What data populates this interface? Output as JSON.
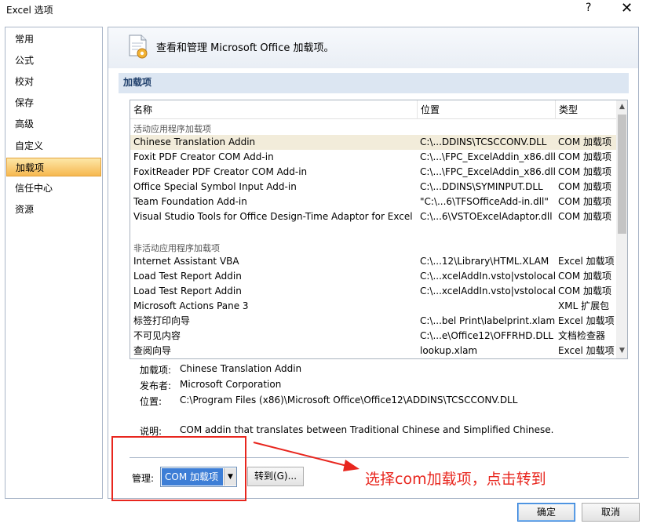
{
  "window": {
    "title": "Excel 选项",
    "help_glyph": "?",
    "close_glyph": "✕"
  },
  "nav": {
    "items": [
      {
        "label": "常用"
      },
      {
        "label": "公式"
      },
      {
        "label": "校对"
      },
      {
        "label": "保存"
      },
      {
        "label": "高级"
      },
      {
        "label": "自定义"
      },
      {
        "label": "加载项",
        "active": true
      },
      {
        "label": "信任中心"
      },
      {
        "label": "资源"
      }
    ]
  },
  "header": {
    "text": "查看和管理 Microsoft Office 加载项。"
  },
  "section": {
    "title": "加载项"
  },
  "table": {
    "columns": [
      "名称",
      "位置",
      "类型"
    ],
    "active_group": "活动应用程序加载项",
    "active_rows": [
      {
        "name": "Chinese Translation Addin",
        "location": "C:\\...DDINS\\TCSCCONV.DLL",
        "type": "COM 加载项"
      },
      {
        "name": "Foxit PDF Creator COM Add-in",
        "location": "C:\\...\\FPC_ExcelAddin_x86.dll",
        "type": "COM 加载项"
      },
      {
        "name": "FoxitReader PDF Creator COM Add-in",
        "location": "C:\\...\\FPC_ExcelAddin_x86.dll",
        "type": "COM 加载项"
      },
      {
        "name": "Office Special Symbol Input Add-in",
        "location": "C:\\...DDINS\\SYMINPUT.DLL",
        "type": "COM 加载项"
      },
      {
        "name": "Team Foundation Add-in",
        "location": "\"C:\\...6\\TFSOfficeAdd-in.dll\"",
        "type": "COM 加载项"
      },
      {
        "name": "Visual Studio Tools for Office Design-Time Adaptor for Excel",
        "location": "C:\\...6\\VSTOExcelAdaptor.dll",
        "type": "COM 加载项"
      }
    ],
    "inactive_group": "非活动应用程序加载项",
    "inactive_rows": [
      {
        "name": "Internet Assistant VBA",
        "location": "C:\\...12\\Library\\HTML.XLAM",
        "type": "Excel 加载项"
      },
      {
        "name": "Load Test Report Addin",
        "location": "C:\\...xcelAddIn.vsto|vstolocal",
        "type": "COM 加载项"
      },
      {
        "name": "Load Test Report Addin",
        "location": "C:\\...xcelAddIn.vsto|vstolocal",
        "type": "COM 加载项"
      },
      {
        "name": "Microsoft Actions Pane 3",
        "location": "",
        "type": "XML 扩展包"
      },
      {
        "name": "标签打印向导",
        "location": "C:\\...bel Print\\labelprint.xlam",
        "type": "Excel 加载项"
      },
      {
        "name": "不可见内容",
        "location": "C:\\...e\\Office12\\OFFRHD.DLL",
        "type": "文档检查器"
      },
      {
        "name": "查阅向导",
        "location": "lookup.xlam",
        "type": "Excel 加载项"
      }
    ]
  },
  "details": {
    "addin_label": "加载项:",
    "addin_value": "Chinese Translation Addin",
    "publisher_label": "发布者:",
    "publisher_value": "Microsoft Corporation",
    "location_label": "位置:",
    "location_value": "C:\\Program Files (x86)\\Microsoft Office\\Office12\\ADDINS\\TCSCCONV.DLL",
    "description_label": "说明:",
    "description_value": "COM addin that translates between Traditional Chinese and Simplified Chinese."
  },
  "manage": {
    "label": "管理:",
    "selected": "COM 加载项",
    "go_label": "转到(G)..."
  },
  "buttons": {
    "ok": "确定",
    "cancel": "取消"
  },
  "annotation": {
    "text": "选择com加载项，点击转到",
    "color": "#e8261e"
  }
}
